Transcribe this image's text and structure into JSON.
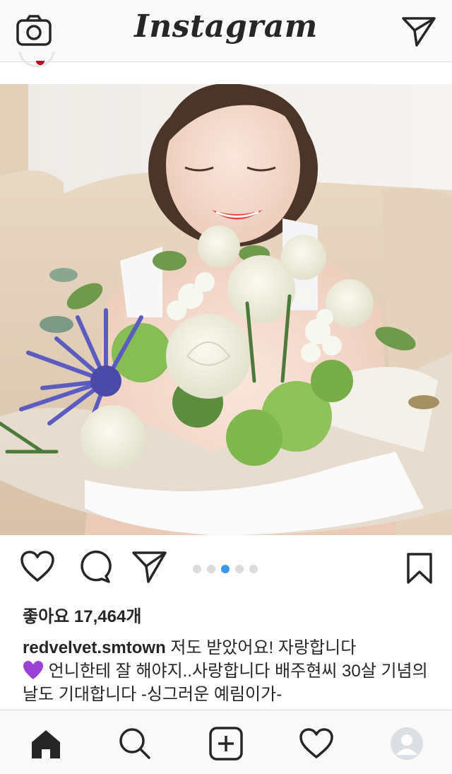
{
  "header": {
    "logo": "Instagram",
    "camera_icon": "camera-icon",
    "direct_icon": "paper-plane-icon"
  },
  "post": {
    "carousel": {
      "count": 5,
      "active_index": 2
    },
    "likes": "좋아요 17,464개",
    "username": "redvelvet.smtown",
    "caption_line1": " 저도 받았어요! 자랑합니다",
    "caption_line2": " 언니한테 잘 해야지..사랑합니다 배주현씨 30살 기념의 날도 기대합니다 -싱그러운 예림이가-",
    "emoji": "purple-heart-emoji"
  },
  "tabbar": {
    "items": [
      "home-icon",
      "search-icon",
      "add-post-icon",
      "heart-icon",
      "profile-avatar"
    ]
  },
  "colors": {
    "accent": "#3897f0",
    "text": "#262626",
    "border": "#dbdbdb"
  }
}
